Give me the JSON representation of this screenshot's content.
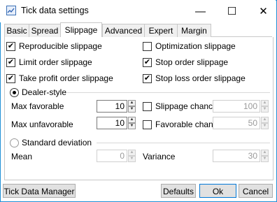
{
  "window": {
    "title": "Tick data settings",
    "app_icon": "tick-data-icon"
  },
  "titlebar_buttons": {
    "minimize": "—",
    "maximize": "☐",
    "close": "✕"
  },
  "tabs": [
    "Basic",
    "Spread",
    "Slippage",
    "Advanced",
    "Expert",
    "Margin"
  ],
  "active_tab": "Slippage",
  "checkboxes": {
    "reproducible": {
      "label": "Reproducible slippage",
      "checked": true
    },
    "optimization": {
      "label": "Optimization slippage",
      "checked": false
    },
    "limit": {
      "label": "Limit order slippage",
      "checked": true
    },
    "stop": {
      "label": "Stop order slippage",
      "checked": true
    },
    "take_profit": {
      "label": "Take profit order slippage",
      "checked": true
    },
    "stop_loss": {
      "label": "Stop loss order slippage",
      "checked": true
    }
  },
  "dealer_style": {
    "label": "Dealer-style",
    "selected": true,
    "max_favorable": {
      "label": "Max favorable",
      "value": "10"
    },
    "max_unfavorable": {
      "label": "Max unfavorable",
      "value": "10"
    },
    "slippage_chance": {
      "label": "Slippage chance",
      "checked": false,
      "value": "100"
    },
    "favorable_chance": {
      "label": "Favorable chance",
      "checked": false,
      "value": "50"
    }
  },
  "standard_deviation": {
    "label": "Standard deviation",
    "selected": false,
    "mean": {
      "label": "Mean",
      "value": "0"
    },
    "variance": {
      "label": "Variance",
      "value": "30"
    }
  },
  "buttons": {
    "tick_data_manager": "Tick Data Manager",
    "defaults": "Defaults",
    "ok": "Ok",
    "cancel": "Cancel"
  },
  "glyphs": {
    "check": "✔",
    "up": "▲",
    "down": "▼"
  }
}
